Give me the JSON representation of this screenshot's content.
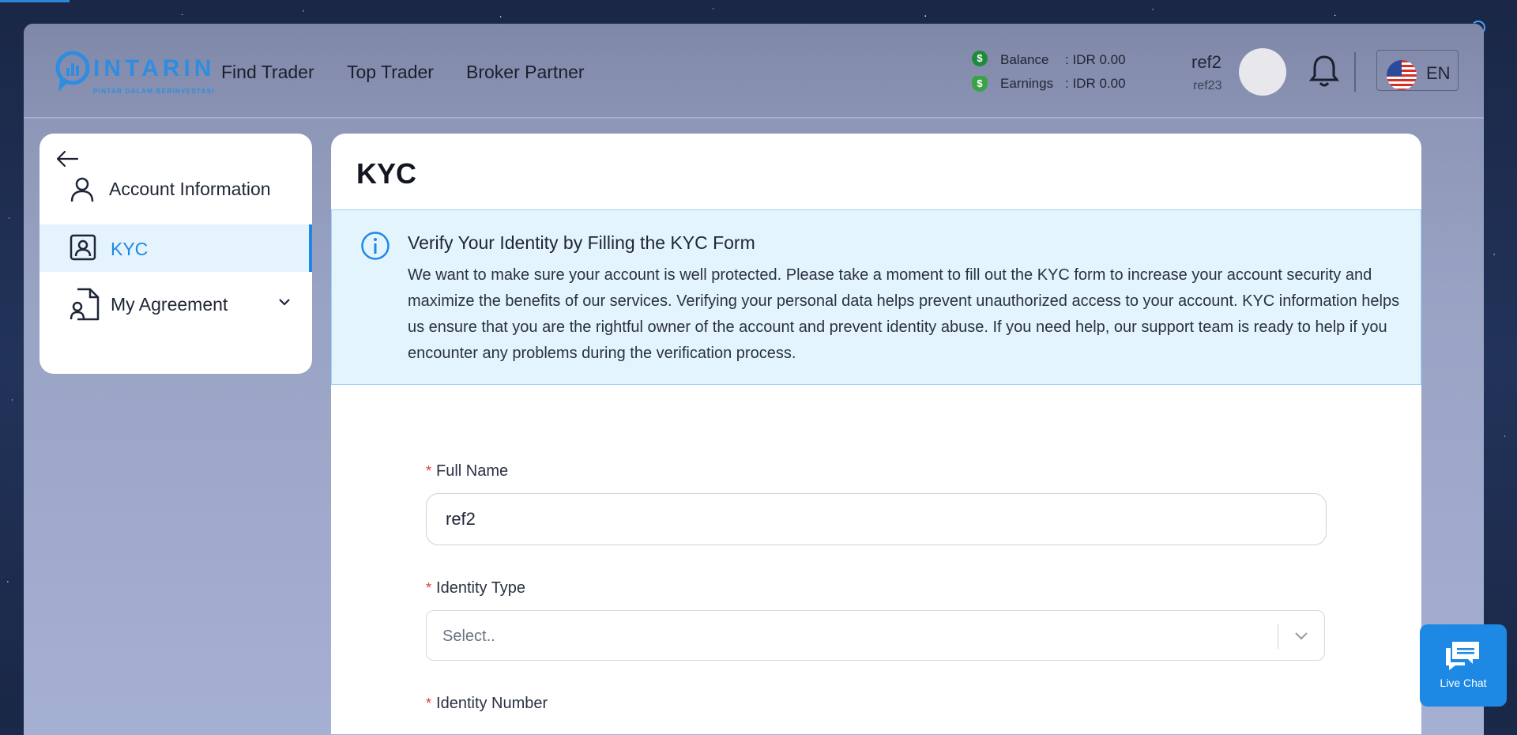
{
  "brand": {
    "name": "INTARIN",
    "tagline": "PINTAR DALAM BERINVESTASI",
    "color": "#2f8de0"
  },
  "nav": {
    "links": [
      "Find Trader",
      "Top Trader",
      "Broker Partner"
    ]
  },
  "wallet": {
    "balance_label": "Balance",
    "balance_value": ": IDR 0.00",
    "earnings_label": "Earnings",
    "earnings_value": ": IDR 0.00"
  },
  "user": {
    "name": "ref2",
    "username": "ref23"
  },
  "language": {
    "code": "EN"
  },
  "sidebar": {
    "items": [
      {
        "label": "Account Information",
        "icon": "user-icon"
      },
      {
        "label": "KYC",
        "icon": "id-card-icon",
        "active": true
      },
      {
        "label": "My Agreement",
        "icon": "document-user-icon"
      }
    ]
  },
  "main": {
    "title": "KYC",
    "alert": {
      "title": "Verify Your Identity by Filling the KYC Form",
      "body": "We want to make sure your account is well protected. Please take a moment to fill out the KYC form to increase your account security and maximize the benefits of our services. Verifying your personal data helps prevent unauthorized access to your account. KYC information helps us ensure that you are the rightful owner of the account and prevent identity abuse. If you need help, our support team is ready to help if you encounter any problems during the verification process."
    },
    "form": {
      "required_mark": "*",
      "full_name_label": "Full Name",
      "full_name_value": "ref2",
      "identity_type_label": "Identity Type",
      "identity_type_placeholder": "Select..",
      "identity_number_label": "Identity Number"
    }
  },
  "live_chat": {
    "label": "Live Chat"
  },
  "colors": {
    "accent": "#1e88e5",
    "alert_bg": "#e4f4fd",
    "required": "#e53935"
  }
}
